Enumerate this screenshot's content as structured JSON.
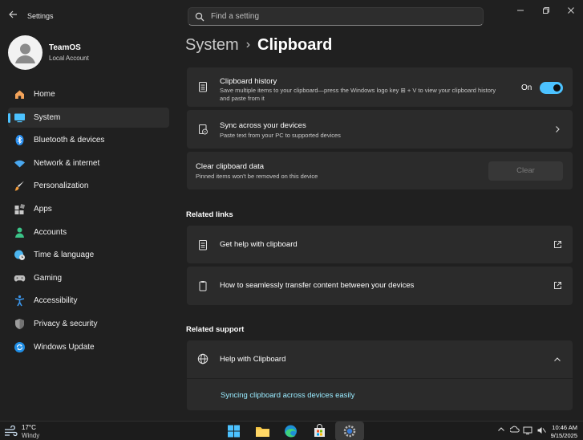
{
  "app": {
    "title": "Settings"
  },
  "search": {
    "placeholder": "Find a setting"
  },
  "profile": {
    "name": "TeamOS",
    "account_type": "Local Account"
  },
  "sidebar": {
    "items": [
      {
        "label": "Home",
        "icon": "home-icon"
      },
      {
        "label": "System",
        "icon": "system-icon",
        "active": true
      },
      {
        "label": "Bluetooth & devices",
        "icon": "bluetooth-icon"
      },
      {
        "label": "Network & internet",
        "icon": "wifi-icon"
      },
      {
        "label": "Personalization",
        "icon": "brush-icon"
      },
      {
        "label": "Apps",
        "icon": "apps-icon"
      },
      {
        "label": "Accounts",
        "icon": "accounts-icon"
      },
      {
        "label": "Time & language",
        "icon": "globe-clock-icon"
      },
      {
        "label": "Gaming",
        "icon": "gamepad-icon"
      },
      {
        "label": "Accessibility",
        "icon": "accessibility-icon"
      },
      {
        "label": "Privacy & security",
        "icon": "shield-icon"
      },
      {
        "label": "Windows Update",
        "icon": "update-icon"
      }
    ]
  },
  "breadcrumb": {
    "parent": "System",
    "separator": "›",
    "current": "Clipboard"
  },
  "clipboard_history": {
    "title": "Clipboard history",
    "description": "Save multiple items to your clipboard—press the Windows logo key ⊞ + V to view your clipboard history and paste from it",
    "state_label": "On",
    "enabled": true
  },
  "sync": {
    "title": "Sync across your devices",
    "description": "Paste text from your PC to supported devices"
  },
  "clear": {
    "title": "Clear clipboard data",
    "description": "Pinned items won't be removed on this device",
    "button_label": "Clear"
  },
  "related_links": {
    "heading": "Related links",
    "items": [
      {
        "label": "Get help with clipboard"
      },
      {
        "label": "How to seamlessly transfer content between your devices"
      }
    ]
  },
  "related_support": {
    "heading": "Related support",
    "title": "Help with Clipboard",
    "link": "Syncing clipboard across devices easily"
  },
  "taskbar": {
    "weather": {
      "temp": "17°C",
      "condition": "Windy"
    },
    "clock": {
      "time": "10:46 AM",
      "date": "9/15/2025"
    }
  },
  "colors": {
    "accent": "#4cc2ff",
    "link": "#99ebff",
    "background": "#202020",
    "card": "#2b2b2b"
  }
}
